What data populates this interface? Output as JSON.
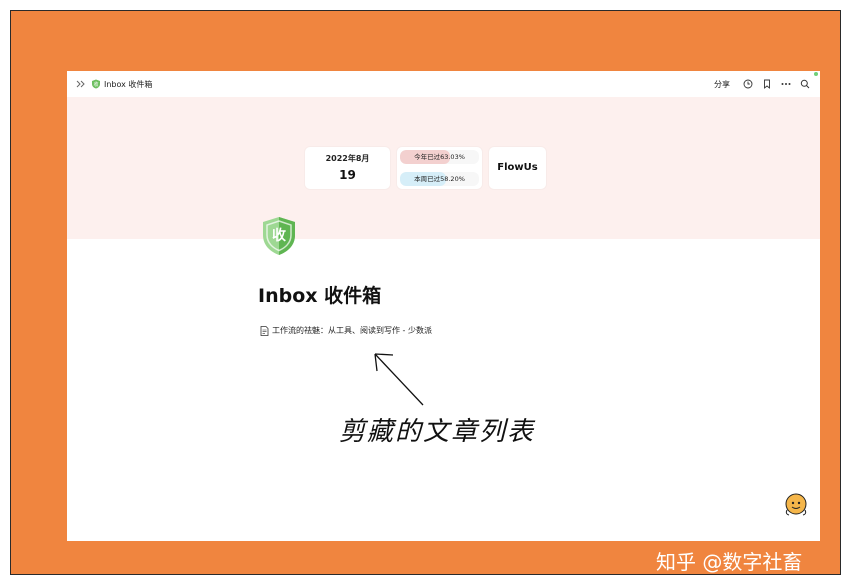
{
  "breadcrumb": {
    "title": "Inbox 收件箱"
  },
  "toolbar": {
    "share_label": "分享"
  },
  "widgets": {
    "date_label": "2022年8月",
    "day": "19",
    "year_progress": {
      "text": "今年已过63.03%",
      "value": 63.03,
      "color": "#f3d0cf"
    },
    "week_progress": {
      "text": "本周已过58.20%",
      "value": 58.2,
      "color": "#d6eef8"
    },
    "brand": "FlowUs"
  },
  "page": {
    "icon_char": "收",
    "title": "Inbox 收件箱",
    "subpages": [
      {
        "label": "工作流的祛魅：从工具、阅读到写作 - 少数派"
      }
    ]
  },
  "annotation": {
    "text": "剪藏的文章列表"
  },
  "watermark": {
    "text": "知乎 @数字社畜"
  },
  "colors": {
    "frame_bg": "#f0853f",
    "cover_bg": "#fdf0ee",
    "shield_green": "#6cbf5f"
  }
}
